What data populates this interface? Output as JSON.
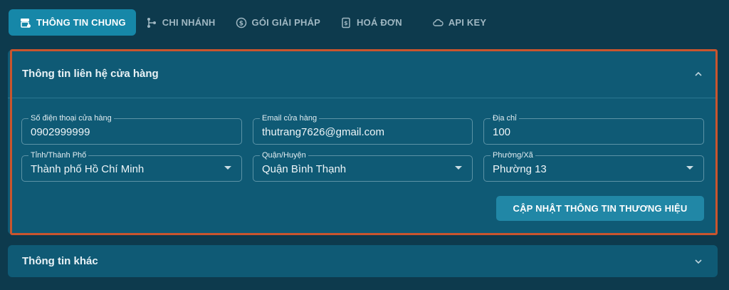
{
  "tabs": [
    {
      "label": "THÔNG TIN CHUNG",
      "icon": "store-settings-icon",
      "active": true
    },
    {
      "label": "CHI NHÁNH",
      "icon": "branch-icon",
      "active": false
    },
    {
      "label": "GÓI GIẢI PHÁP",
      "icon": "package-icon",
      "active": false
    },
    {
      "label": "HOÁ ĐƠN",
      "icon": "invoice-icon",
      "active": false
    },
    {
      "label": "API KEY",
      "icon": "cloud-key-icon",
      "active": false
    }
  ],
  "contact_panel": {
    "title": "Thông tin liên hệ cửa hàng",
    "fields": {
      "phone": {
        "label": "Số điện thoại cửa hàng",
        "value": "0902999999"
      },
      "email": {
        "label": "Email cửa hàng",
        "value": "thutrang7626@gmail.com"
      },
      "address": {
        "label": "Địa chỉ",
        "value": "100"
      },
      "province": {
        "label": "Tỉnh/Thành Phố",
        "value": "Thành phố Hồ Chí Minh"
      },
      "district": {
        "label": "Quận/Huyện",
        "value": "Quận Bình Thạnh"
      },
      "ward": {
        "label": "Phường/Xã",
        "value": "Phường 13"
      }
    },
    "submit_label": "CẬP NHẬT THÔNG TIN THƯƠNG HIỆU"
  },
  "other_panel": {
    "title": "Thông tin khác"
  },
  "colors": {
    "background": "#0d3a4d",
    "panel": "#0f5a75",
    "accent": "#1687a8",
    "highlight_border": "#c9552e"
  }
}
